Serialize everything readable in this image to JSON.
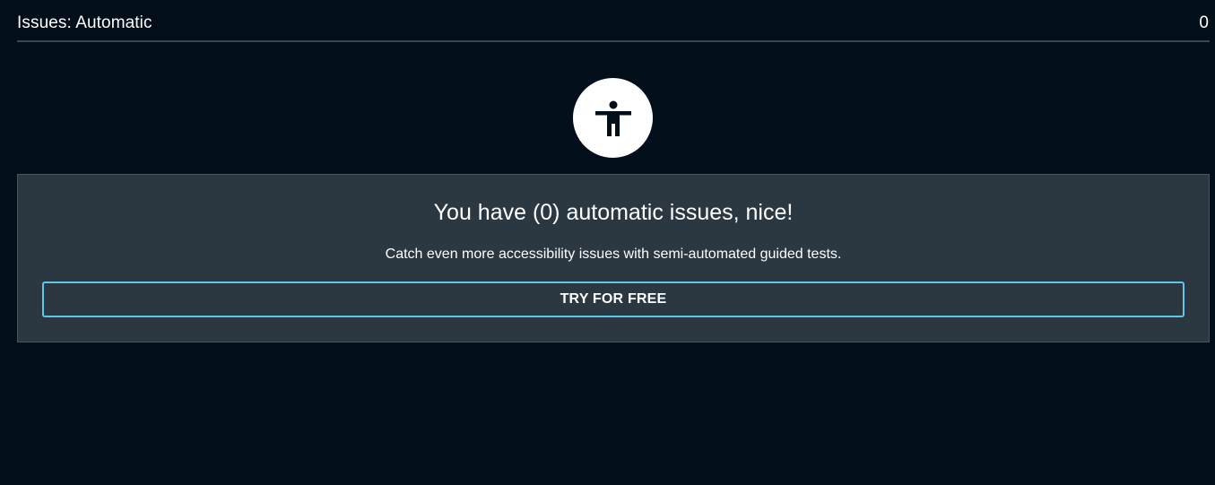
{
  "header": {
    "title": "Issues: Automatic",
    "count": "0"
  },
  "hero": {
    "icon": "accessibility-person-icon"
  },
  "card": {
    "heading": "You have (0) automatic issues, nice!",
    "subtext": "Catch even more accessibility issues with semi-automated guided tests.",
    "cta_label": "TRY FOR FREE"
  },
  "colors": {
    "background": "#020f1a",
    "card_background": "#2b3741",
    "accent": "#5ec8e6",
    "divider": "#3a4650"
  }
}
